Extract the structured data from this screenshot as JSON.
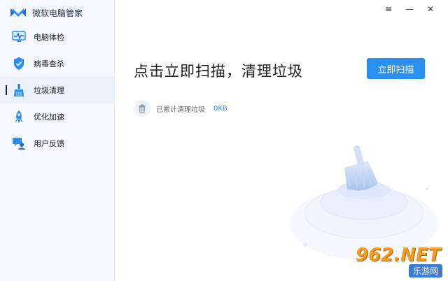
{
  "app": {
    "title": "微软电脑管家"
  },
  "window_controls": {
    "menu": "≡",
    "minimize": "—",
    "close": "✕"
  },
  "sidebar": {
    "items": [
      {
        "label": "电脑体检",
        "icon": "monitor-pulse-icon",
        "active": false
      },
      {
        "label": "病毒查杀",
        "icon": "shield-icon",
        "active": false
      },
      {
        "label": "垃圾清理",
        "icon": "broom-icon",
        "active": true
      },
      {
        "label": "优化加速",
        "icon": "rocket-icon",
        "active": false
      },
      {
        "label": "用户反馈",
        "icon": "feedback-icon",
        "active": false
      }
    ]
  },
  "main": {
    "title": "点击立即扫描，清理垃圾",
    "scan_button": "立即扫描",
    "cleaned_label": "已累计清理垃圾",
    "cleaned_value": "0KB"
  },
  "watermark": {
    "big": "962.NET",
    "small": "乐游网"
  },
  "colors": {
    "accent": "#2b8ff0",
    "sidebar_bg": "#f5f9ff",
    "active_bg": "#eaf1fb"
  }
}
